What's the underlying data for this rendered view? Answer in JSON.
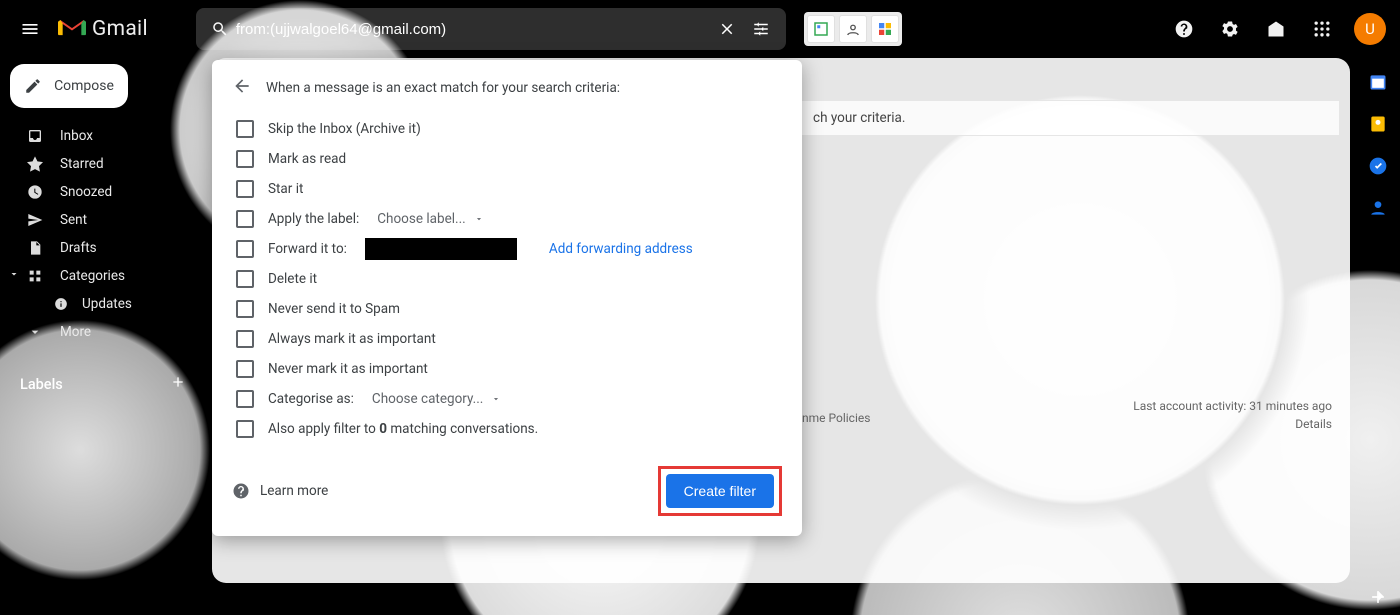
{
  "header": {
    "product": "Gmail",
    "search_value": "from:(ujjwalgoel64@gmail.com)",
    "avatar_initial": "U"
  },
  "background_message": "ch your criteria.",
  "compose_label": "Compose",
  "nav": {
    "inbox": "Inbox",
    "starred": "Starred",
    "snoozed": "Snoozed",
    "sent": "Sent",
    "drafts": "Drafts",
    "categories": "Categories",
    "updates": "Updates",
    "more": "More"
  },
  "labels_header": "Labels",
  "popup": {
    "title": "When a message is an exact match for your search criteria:",
    "opt_skip": "Skip the Inbox (Archive it)",
    "opt_read": "Mark as read",
    "opt_star": "Star it",
    "opt_label_pre": "Apply the label:",
    "opt_label_sel": "Choose label...",
    "opt_fwd_pre": "Forward it to:",
    "add_fwd": "Add forwarding address",
    "opt_delete": "Delete it",
    "opt_nospam": "Never send it to Spam",
    "opt_imp": "Always mark it as important",
    "opt_noimp": "Never mark it as important",
    "opt_cat_pre": "Categorise as:",
    "opt_cat_sel": "Choose category...",
    "opt_apply_pre": "Also apply filter to ",
    "opt_apply_count": "0",
    "opt_apply_post": " matching conversations.",
    "learn_more": "Learn more",
    "create": "Create filter"
  },
  "footer": {
    "policies": "nme Policies",
    "activity": "Last account activity: 31 minutes ago",
    "details": "Details"
  }
}
